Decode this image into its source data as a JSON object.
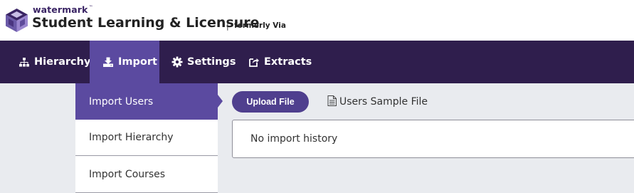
{
  "brand": {
    "wordmark": "watermark",
    "trademark": "™",
    "product_title": "Student Learning & Licensure",
    "separator": "|",
    "formerly": "formerly Via",
    "colors": {
      "primary_dark": "#2f1e4d",
      "accent": "#5b4aa0",
      "button": "#4f3f8e",
      "background": "#e9ebef"
    }
  },
  "topnav": {
    "items": [
      {
        "label": "Hierarchy",
        "icon": "sitemap-icon",
        "active": false
      },
      {
        "label": "Import",
        "icon": "download-icon",
        "active": true
      },
      {
        "label": "Settings",
        "icon": "gear-icon",
        "active": false
      },
      {
        "label": "Extracts",
        "icon": "share-icon",
        "active": false
      }
    ]
  },
  "sidemenu": {
    "items": [
      {
        "label": "Import Users",
        "active": true
      },
      {
        "label": "Import Hierarchy",
        "active": false
      },
      {
        "label": "Import Courses",
        "active": false
      }
    ]
  },
  "content": {
    "upload_label": "Upload File",
    "sample_label": "Users Sample File",
    "sample_icon": "document-icon",
    "history_empty": "No import history"
  }
}
